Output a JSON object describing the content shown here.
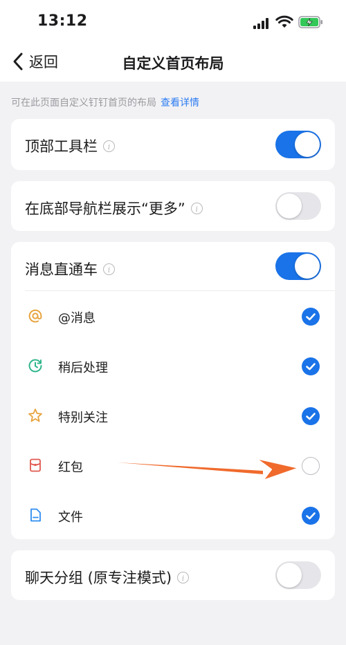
{
  "status": {
    "time": "13:12"
  },
  "nav": {
    "back_label": "返回",
    "title": "自定义首页布局"
  },
  "hint": {
    "text": "可在此页面自定义钉钉首页的布局",
    "link": "查看详情"
  },
  "sections": {
    "toolbar": {
      "label": "顶部工具栏",
      "enabled": true
    },
    "more": {
      "label": "在底部导航栏展示“更多”",
      "enabled": false
    },
    "direct": {
      "label": "消息直通车",
      "enabled": true,
      "items": [
        {
          "label": "@消息",
          "icon": "at-icon",
          "color": "#e8a33d",
          "checked": true
        },
        {
          "label": "稍后处理",
          "icon": "clock-icon",
          "color": "#2fb58c",
          "checked": true
        },
        {
          "label": "特别关注",
          "icon": "star-icon",
          "color": "#e8a33d",
          "checked": true
        },
        {
          "label": "红包",
          "icon": "red-packet-icon",
          "color": "#e0584f",
          "checked": false
        },
        {
          "label": "文件",
          "icon": "file-icon",
          "color": "#2d8cf0",
          "checked": true
        }
      ]
    },
    "chatgroup": {
      "label": "聊天分组 (原专注模式)",
      "enabled": false
    }
  },
  "colors": {
    "accent": "#1a73e8",
    "arrow": "#f06a2c",
    "link": "#2d7cf2"
  }
}
